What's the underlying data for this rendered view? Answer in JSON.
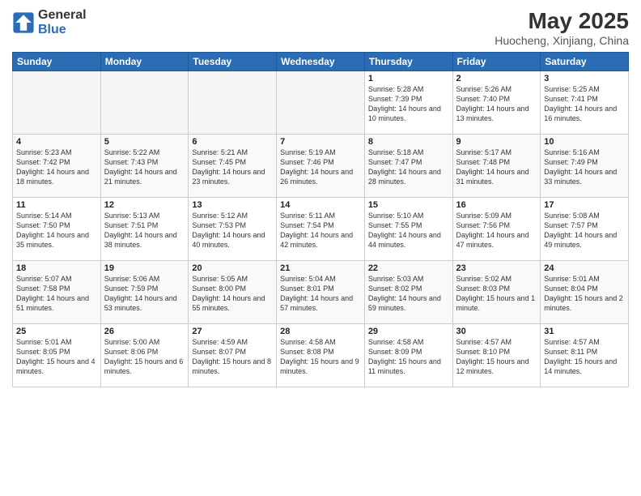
{
  "logo": {
    "text_general": "General",
    "text_blue": "Blue"
  },
  "title": "May 2025",
  "subtitle": "Huocheng, Xinjiang, China",
  "days_of_week": [
    "Sunday",
    "Monday",
    "Tuesday",
    "Wednesday",
    "Thursday",
    "Friday",
    "Saturday"
  ],
  "weeks": [
    {
      "days": [
        {
          "num": "",
          "empty": true
        },
        {
          "num": "",
          "empty": true
        },
        {
          "num": "",
          "empty": true
        },
        {
          "num": "",
          "empty": true
        },
        {
          "num": "1",
          "sunrise": "5:28 AM",
          "sunset": "7:39 PM",
          "daylight": "14 hours and 10 minutes."
        },
        {
          "num": "2",
          "sunrise": "5:26 AM",
          "sunset": "7:40 PM",
          "daylight": "14 hours and 13 minutes."
        },
        {
          "num": "3",
          "sunrise": "5:25 AM",
          "sunset": "7:41 PM",
          "daylight": "14 hours and 16 minutes."
        }
      ]
    },
    {
      "days": [
        {
          "num": "4",
          "sunrise": "5:23 AM",
          "sunset": "7:42 PM",
          "daylight": "14 hours and 18 minutes."
        },
        {
          "num": "5",
          "sunrise": "5:22 AM",
          "sunset": "7:43 PM",
          "daylight": "14 hours and 21 minutes."
        },
        {
          "num": "6",
          "sunrise": "5:21 AM",
          "sunset": "7:45 PM",
          "daylight": "14 hours and 23 minutes."
        },
        {
          "num": "7",
          "sunrise": "5:19 AM",
          "sunset": "7:46 PM",
          "daylight": "14 hours and 26 minutes."
        },
        {
          "num": "8",
          "sunrise": "5:18 AM",
          "sunset": "7:47 PM",
          "daylight": "14 hours and 28 minutes."
        },
        {
          "num": "9",
          "sunrise": "5:17 AM",
          "sunset": "7:48 PM",
          "daylight": "14 hours and 31 minutes."
        },
        {
          "num": "10",
          "sunrise": "5:16 AM",
          "sunset": "7:49 PM",
          "daylight": "14 hours and 33 minutes."
        }
      ]
    },
    {
      "days": [
        {
          "num": "11",
          "sunrise": "5:14 AM",
          "sunset": "7:50 PM",
          "daylight": "14 hours and 35 minutes."
        },
        {
          "num": "12",
          "sunrise": "5:13 AM",
          "sunset": "7:51 PM",
          "daylight": "14 hours and 38 minutes."
        },
        {
          "num": "13",
          "sunrise": "5:12 AM",
          "sunset": "7:53 PM",
          "daylight": "14 hours and 40 minutes."
        },
        {
          "num": "14",
          "sunrise": "5:11 AM",
          "sunset": "7:54 PM",
          "daylight": "14 hours and 42 minutes."
        },
        {
          "num": "15",
          "sunrise": "5:10 AM",
          "sunset": "7:55 PM",
          "daylight": "14 hours and 44 minutes."
        },
        {
          "num": "16",
          "sunrise": "5:09 AM",
          "sunset": "7:56 PM",
          "daylight": "14 hours and 47 minutes."
        },
        {
          "num": "17",
          "sunrise": "5:08 AM",
          "sunset": "7:57 PM",
          "daylight": "14 hours and 49 minutes."
        }
      ]
    },
    {
      "days": [
        {
          "num": "18",
          "sunrise": "5:07 AM",
          "sunset": "7:58 PM",
          "daylight": "14 hours and 51 minutes."
        },
        {
          "num": "19",
          "sunrise": "5:06 AM",
          "sunset": "7:59 PM",
          "daylight": "14 hours and 53 minutes."
        },
        {
          "num": "20",
          "sunrise": "5:05 AM",
          "sunset": "8:00 PM",
          "daylight": "14 hours and 55 minutes."
        },
        {
          "num": "21",
          "sunrise": "5:04 AM",
          "sunset": "8:01 PM",
          "daylight": "14 hours and 57 minutes."
        },
        {
          "num": "22",
          "sunrise": "5:03 AM",
          "sunset": "8:02 PM",
          "daylight": "14 hours and 59 minutes."
        },
        {
          "num": "23",
          "sunrise": "5:02 AM",
          "sunset": "8:03 PM",
          "daylight": "15 hours and 1 minute."
        },
        {
          "num": "24",
          "sunrise": "5:01 AM",
          "sunset": "8:04 PM",
          "daylight": "15 hours and 2 minutes."
        }
      ]
    },
    {
      "days": [
        {
          "num": "25",
          "sunrise": "5:01 AM",
          "sunset": "8:05 PM",
          "daylight": "15 hours and 4 minutes."
        },
        {
          "num": "26",
          "sunrise": "5:00 AM",
          "sunset": "8:06 PM",
          "daylight": "15 hours and 6 minutes."
        },
        {
          "num": "27",
          "sunrise": "4:59 AM",
          "sunset": "8:07 PM",
          "daylight": "15 hours and 8 minutes."
        },
        {
          "num": "28",
          "sunrise": "4:58 AM",
          "sunset": "8:08 PM",
          "daylight": "15 hours and 9 minutes."
        },
        {
          "num": "29",
          "sunrise": "4:58 AM",
          "sunset": "8:09 PM",
          "daylight": "15 hours and 11 minutes."
        },
        {
          "num": "30",
          "sunrise": "4:57 AM",
          "sunset": "8:10 PM",
          "daylight": "15 hours and 12 minutes."
        },
        {
          "num": "31",
          "sunrise": "4:57 AM",
          "sunset": "8:11 PM",
          "daylight": "15 hours and 14 minutes."
        }
      ]
    }
  ]
}
